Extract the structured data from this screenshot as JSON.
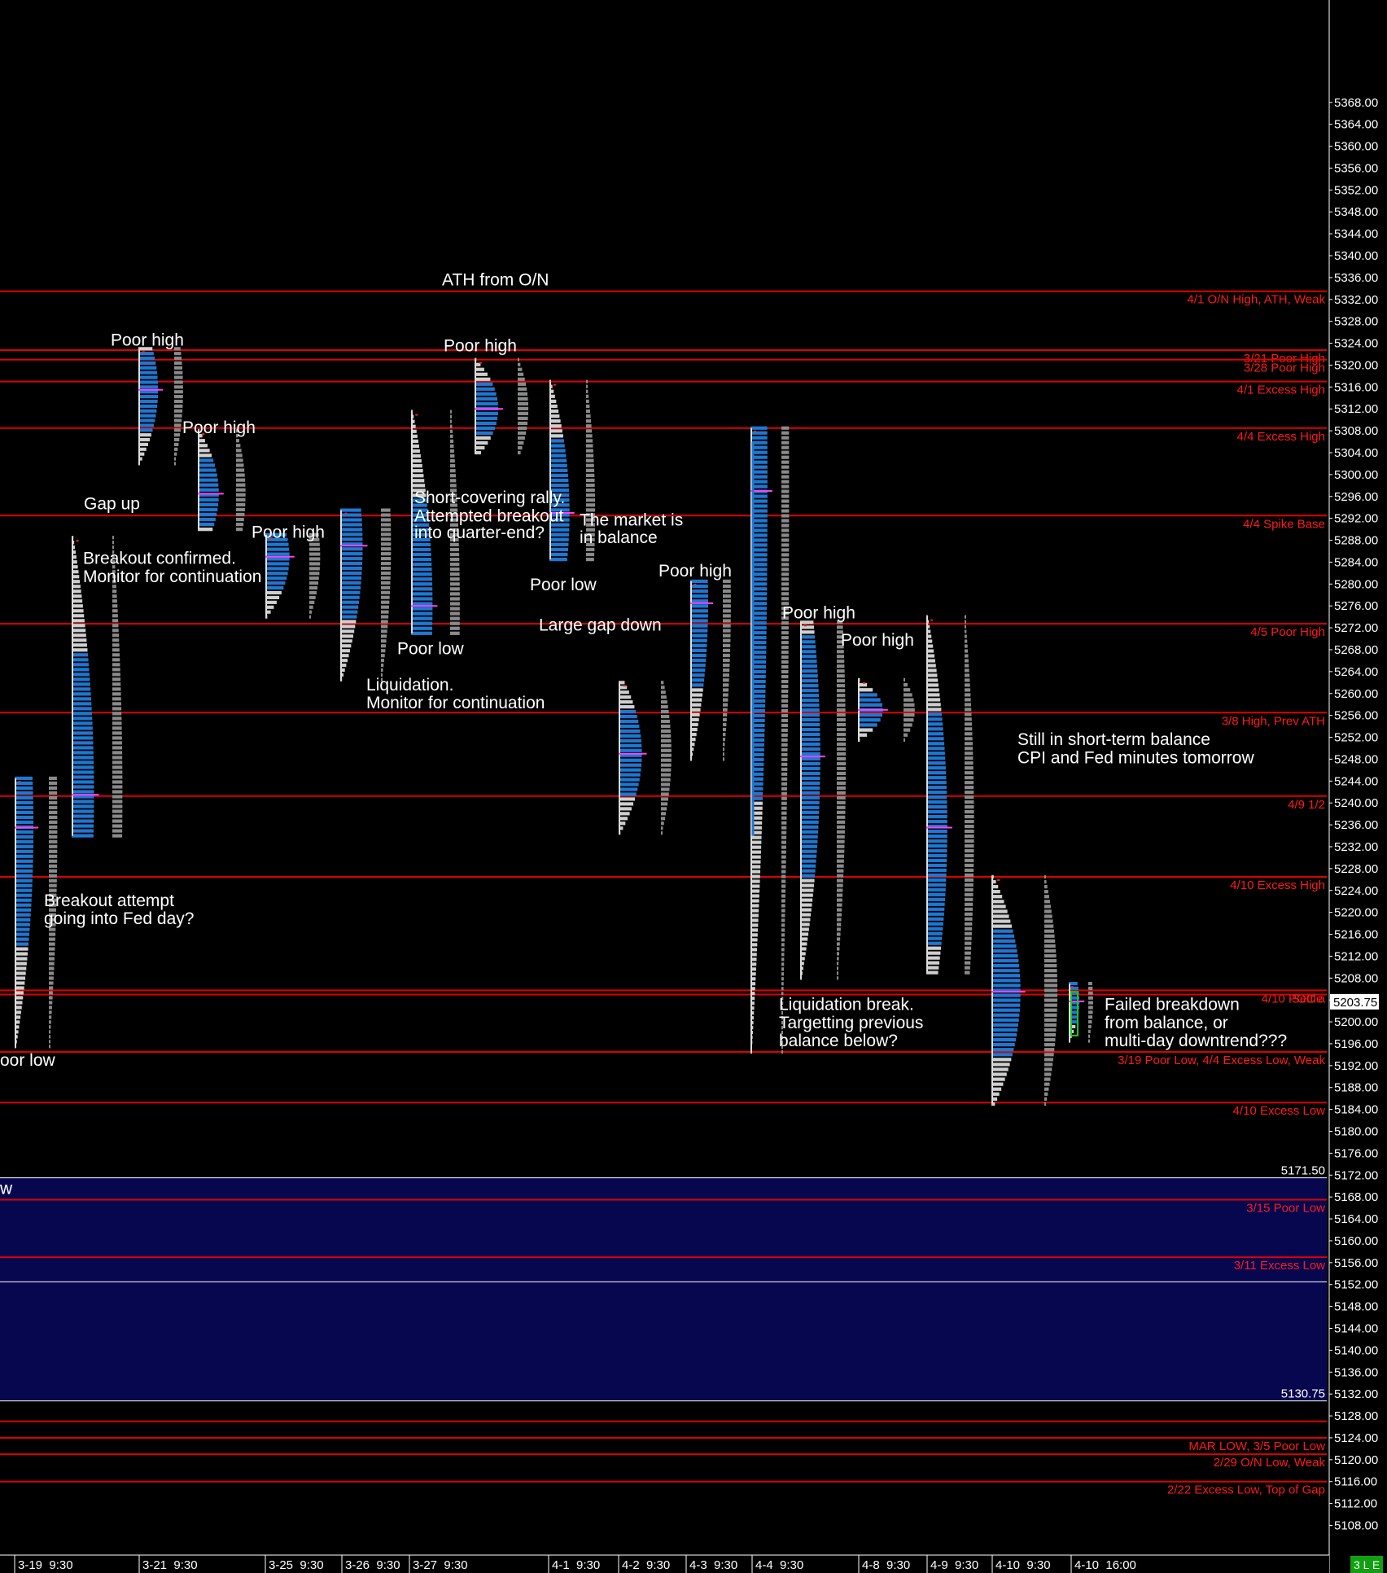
{
  "chart_data": {
    "type": "market-profile",
    "y_axis": {
      "range": [
        5105.5,
        5370.5
      ],
      "tick_step": 4,
      "tick_first": 5108,
      "tick_last": 5368,
      "tick_format": "0.00",
      "side": "right"
    },
    "time_labels": [
      "3-19  9:30",
      "3-21  9:30",
      "3-25  9:30",
      "3-26  9:30",
      "3-27  9:30",
      "4-1  9:30",
      "4-2  9:30",
      "4-3  9:30",
      "4-4  9:30",
      "4-8  9:30",
      "4-9  9:30",
      "4-10  9:30",
      "4-10  16:00"
    ],
    "levels": [
      {
        "price": 5333.5,
        "label": "4/1 O/N High, ATH, Weak"
      },
      {
        "price": 5322.75,
        "label": "3/21 Poor High"
      },
      {
        "price": 5321.0,
        "label": "3/28 Poor High"
      },
      {
        "price": 5317.0,
        "label": "4/1 Excess High"
      },
      {
        "price": 5308.5,
        "label": "4/4 Excess High"
      },
      {
        "price": 5292.5,
        "label": "4/4 Spike Base"
      },
      {
        "price": 5272.75,
        "label": "4/5 Poor High"
      },
      {
        "price": 5256.5,
        "label": "3/8 High, Prev ATH"
      },
      {
        "price": 5241.25,
        "label": "4/9 1/2"
      },
      {
        "price": 5226.5,
        "label": "4/10 Excess High"
      },
      {
        "price": 5205.75,
        "label": "4/10 POC a"
      },
      {
        "price": 5205.0,
        "label": ""
      },
      {
        "price": 5194.5,
        "label": "3/19 Poor Low, 4/4 Excess Low, Weak"
      },
      {
        "price": 5185.25,
        "label": "4/10 Excess Low"
      },
      {
        "price": 5167.5,
        "label": "3/15 Poor Low"
      },
      {
        "price": 5157.0,
        "label": "3/11 Excess Low"
      },
      {
        "price": 5127.0,
        "label": ""
      },
      {
        "price": 5124.0,
        "label": "MAR LOW, 3/5 Poor Low"
      },
      {
        "price": 5121.0,
        "label": "2/29 O/N Low, Weak"
      },
      {
        "price": 5116.0,
        "label": "2/22 Excess Low, Top of Gap"
      }
    ],
    "settle_label": "Settle",
    "gap_zone": {
      "top": 5171.5,
      "bottom": 5130.75,
      "top_label": "5171.50",
      "bottom_label": "5130.75",
      "edge_text": "w"
    },
    "last_price": "5203.75",
    "corner_badge": "3 L E",
    "annotations": [
      {
        "text": "ATH from O/N",
        "price": 5335.6,
        "x_label": "4-1"
      },
      {
        "text": "Poor high",
        "price": 5324.6,
        "x_label": "3-21"
      },
      {
        "text": "Poor high",
        "price": 5323.6,
        "x_label": "3-27"
      },
      {
        "text": "Poor high",
        "price": 5308.6,
        "x_label": "3-21"
      },
      {
        "text": "Gap up",
        "price": 5294.7,
        "x_label": "3-19"
      },
      {
        "text": "Short-covering rally.",
        "price": 5295.8,
        "x_label": "3-27"
      },
      {
        "text": "Attempted breakout",
        "price": 5292.5,
        "x_label": "3-27"
      },
      {
        "text": "into quarter-end?",
        "price": 5289.4,
        "x_label": "3-27"
      },
      {
        "text": "The market is",
        "price": 5291.7,
        "x_label": "4-1"
      },
      {
        "text": "in balance",
        "price": 5288.5,
        "x_label": "4-1"
      },
      {
        "text": "Poor high",
        "price": 5289.5,
        "x_label": "3-25"
      },
      {
        "text": "Breakout confirmed.",
        "price": 5284.7,
        "x_label": "3-19"
      },
      {
        "text": "Monitor for continuation",
        "price": 5281.4,
        "x_label": "3-19"
      },
      {
        "text": "Poor high",
        "price": 5282.4,
        "x_label": "4-2"
      },
      {
        "text": "Poor low",
        "price": 5279.9,
        "x_label": "4-1"
      },
      {
        "text": "Poor high",
        "price": 5274.8,
        "x_label": "4-4"
      },
      {
        "text": "Large gap down",
        "price": 5272.5,
        "x_label": "4-1"
      },
      {
        "text": "Poor high",
        "price": 5269.8,
        "x_label": "4-8"
      },
      {
        "text": "Poor low",
        "price": 5268.2,
        "x_label": "3-27"
      },
      {
        "text": "Liquidation.",
        "price": 5261.6,
        "x_label": "3-26"
      },
      {
        "text": "Monitor for continuation",
        "price": 5258.3,
        "x_label": "3-26"
      },
      {
        "text": "Still in short-term balance",
        "price": 5251.6,
        "x_label": "4-9"
      },
      {
        "text": "CPI and Fed minutes tomorrow",
        "price": 5248.3,
        "x_label": "4-9"
      },
      {
        "text": "Breakout attempt",
        "price": 5222.2,
        "x_label": "3-19"
      },
      {
        "text": "going into Fed day?",
        "price": 5218.9,
        "x_label": "3-19"
      },
      {
        "text": "Liquidation break.",
        "price": 5203.2,
        "x_label": "4-4"
      },
      {
        "text": "Targetting previous",
        "price": 5199.9,
        "x_label": "4-4"
      },
      {
        "text": "balance below?",
        "price": 5196.6,
        "x_label": "4-4"
      },
      {
        "text": "Failed breakdown",
        "price": 5203.2,
        "x_label": "4-10"
      },
      {
        "text": "from balance, or",
        "price": 5199.9,
        "x_label": "4-10"
      },
      {
        "text": "multi-day downtrend???",
        "price": 5196.6,
        "x_label": "4-10"
      },
      {
        "text": "oor low",
        "price": 5193.0,
        "x_label": "3-19"
      }
    ],
    "profiles": [
      {
        "session": "3-19",
        "high": 5244.5,
        "low": 5195.5,
        "poc": 5235.5
      },
      {
        "session": "3-20",
        "high": 5288.5,
        "low": 5234.0,
        "poc": 5241.5
      },
      {
        "session": "3-21",
        "high": 5323.0,
        "low": 5302.0,
        "poc": 5315.5
      },
      {
        "session": "3-22",
        "high": 5308.0,
        "low": 5290.0,
        "poc": 5296.5
      },
      {
        "session": "3-25",
        "high": 5289.0,
        "low": 5274.0,
        "poc": 5285.0
      },
      {
        "session": "3-26",
        "high": 5293.5,
        "low": 5262.5,
        "poc": 5287.0
      },
      {
        "session": "3-27",
        "high": 5311.5,
        "low": 5271.0,
        "poc": 5276.0
      },
      {
        "session": "3-28",
        "high": 5321.0,
        "low": 5304.0,
        "poc": 5312.0
      },
      {
        "session": "4-1",
        "high": 5317.0,
        "low": 5284.5,
        "poc": 5293.0
      },
      {
        "session": "4-2",
        "high": 5262.0,
        "low": 5234.5,
        "poc": 5249.0
      },
      {
        "session": "4-3",
        "high": 5280.5,
        "low": 5248.0,
        "poc": 5276.5
      },
      {
        "session": "4-4",
        "high": 5308.5,
        "low": 5194.5,
        "poc": 5297.0
      },
      {
        "session": "4-5",
        "high": 5273.0,
        "low": 5208.0,
        "poc": 5248.5
      },
      {
        "session": "4-8",
        "high": 5262.5,
        "low": 5251.5,
        "poc": 5257.0
      },
      {
        "session": "4-9",
        "high": 5274.0,
        "low": 5209.0,
        "poc": 5235.5
      },
      {
        "session": "4-10",
        "high": 5226.5,
        "low": 5185.0,
        "poc": 5205.5
      },
      {
        "session": "4-10 16:00",
        "high": 5207.0,
        "low": 5196.5,
        "poc": 5203.75
      }
    ]
  }
}
